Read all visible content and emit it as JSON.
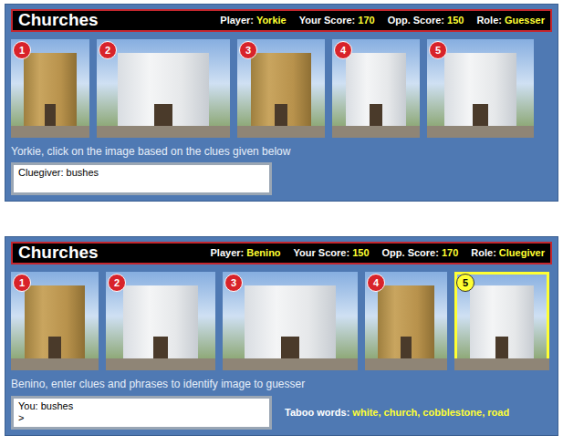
{
  "panels": [
    {
      "title": "Churches",
      "player_label": "Player:",
      "player": "Yorkie",
      "your_score_label": "Your Score:",
      "your_score": "170",
      "opp_score_label": "Opp. Score:",
      "opp_score": "150",
      "role_label": "Role:",
      "role": "Guesser",
      "photos": [
        {
          "number": "1",
          "selected": false,
          "kind": "yellow"
        },
        {
          "number": "2",
          "selected": false,
          "kind": "white"
        },
        {
          "number": "3",
          "selected": false,
          "kind": "yellow"
        },
        {
          "number": "4",
          "selected": false,
          "kind": "white"
        },
        {
          "number": "5",
          "selected": false,
          "kind": "white"
        }
      ],
      "instruction": "Yorkie, click on the image based on the clues given below",
      "clue_box": {
        "lines": [
          "Cluegiver: bushes"
        ]
      }
    },
    {
      "title": "Churches",
      "player_label": "Player:",
      "player": "Benino",
      "your_score_label": "Your Score:",
      "your_score": "150",
      "opp_score_label": "Opp. Score:",
      "opp_score": "170",
      "role_label": "Role:",
      "role": "Cluegiver",
      "photos": [
        {
          "number": "1",
          "selected": false,
          "kind": "yellow"
        },
        {
          "number": "2",
          "selected": false,
          "kind": "white"
        },
        {
          "number": "3",
          "selected": false,
          "kind": "white"
        },
        {
          "number": "4",
          "selected": false,
          "kind": "yellow"
        },
        {
          "number": "5",
          "selected": true,
          "kind": "white"
        }
      ],
      "instruction": "Benino, enter clues and phrases to identify image to guesser",
      "clue_box": {
        "lines": [
          "You: bushes",
          ">"
        ]
      },
      "taboo": {
        "label": "Taboo words:",
        "words": "white, church, cobblestone, road"
      }
    }
  ]
}
